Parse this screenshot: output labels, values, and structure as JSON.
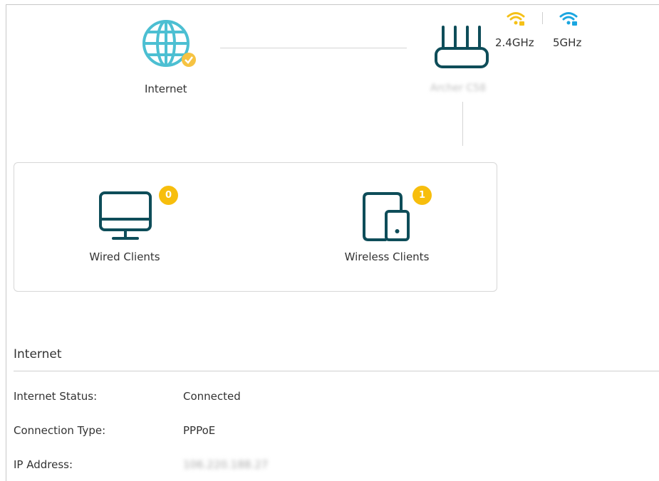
{
  "topology": {
    "internet_label": "Internet",
    "router_name": "Archer C58",
    "bands": {
      "band_24_label": "2.4GHz",
      "band_5_label": "5GHz",
      "band_24_color": "#f5c118",
      "band_5_color": "#1ba6e0"
    },
    "globe_color": "#4cbfd2",
    "router_color": "#0e4d59"
  },
  "clients": {
    "wired": {
      "label": "Wired Clients",
      "count": "0"
    },
    "wireless": {
      "label": "Wireless Clients",
      "count": "1"
    },
    "badge_color": "#f7be0d"
  },
  "internet_section": {
    "title": "Internet",
    "rows": [
      {
        "label": "Internet Status:",
        "value": "Connected"
      },
      {
        "label": "Connection Type:",
        "value": "PPPoE"
      },
      {
        "label": "IP Address:",
        "value": "106.220.188.27"
      }
    ]
  }
}
